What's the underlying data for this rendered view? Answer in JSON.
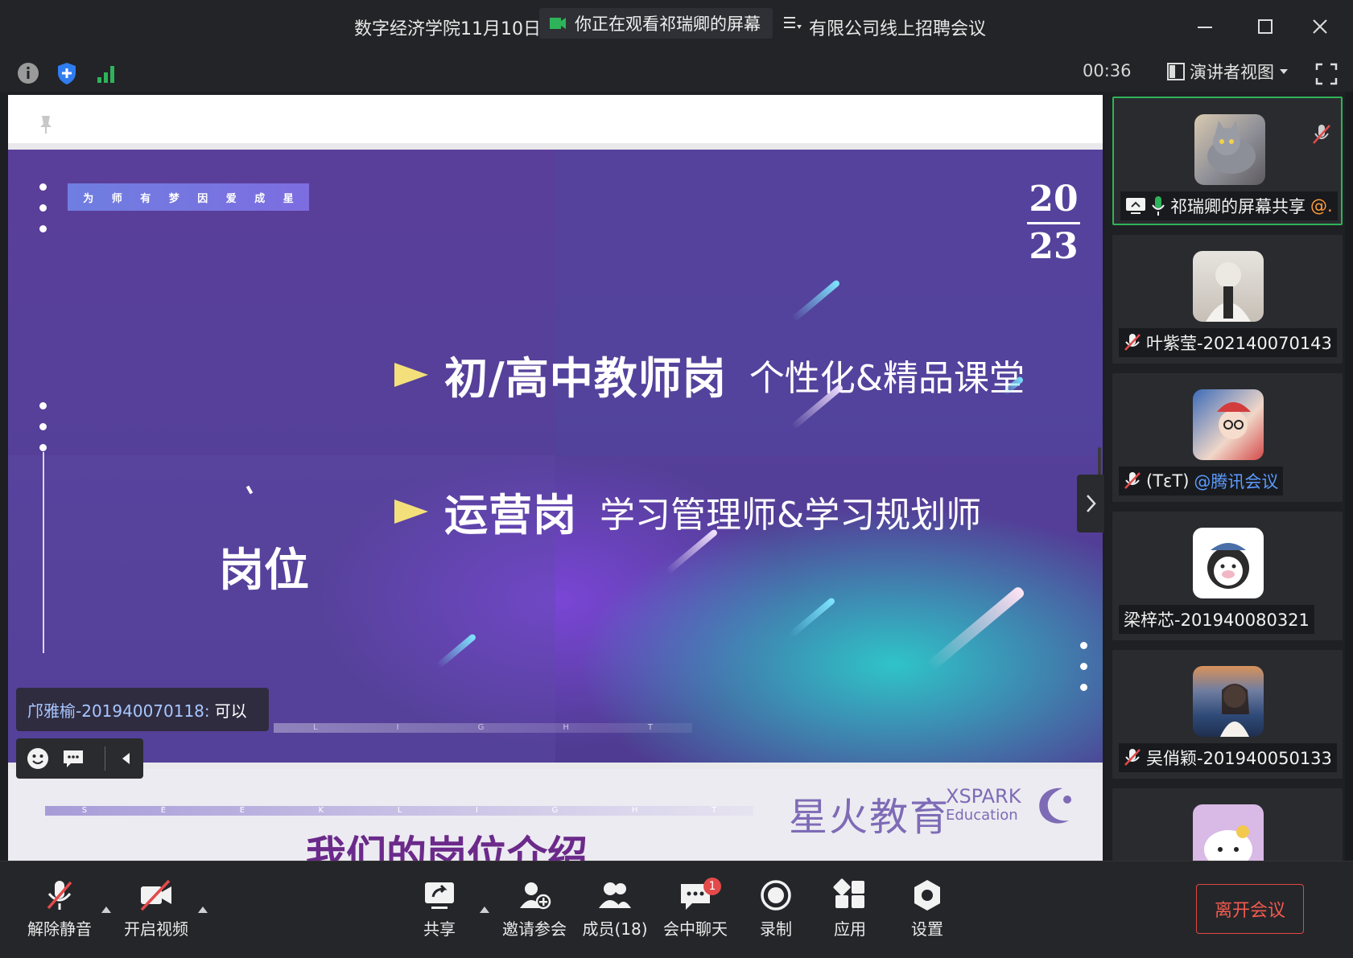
{
  "window": {
    "title_left": "数字经济学院11月10日",
    "title_right": "有限公司线上招聘会议",
    "viewing_banner": "你正在观看祁瑞卿的屏幕"
  },
  "status": {
    "timer": "00:36",
    "view_mode": "演讲者视图"
  },
  "slide": {
    "tagline": [
      "为",
      "师",
      "有",
      "梦",
      "因",
      "爱",
      "成",
      "星"
    ],
    "year_top": "20",
    "year_bottom": "23",
    "row1_main": "初/高中教师岗",
    "row1_sub": "个性化&精品课堂",
    "row2_main": "运营岗",
    "row2_sub": "学习管理师&学习规划师",
    "side_title": "岗位",
    "light_letters": [
      "L",
      "I",
      "G",
      "H",
      "T"
    ],
    "bottom_letters": [
      "S",
      "E",
      "E",
      "K",
      "L",
      "I",
      "G",
      "H",
      "T"
    ],
    "logo_cn": "星火教育",
    "logo_en_1": "XSPARK",
    "logo_en_2": "Education",
    "headline": "我们的岗位介绍"
  },
  "chat": {
    "sender": "邝雅榆-201940070118:",
    "message": "可以"
  },
  "participants": [
    {
      "name": "祁瑞卿的屏幕共享",
      "suffix": "@.",
      "active": true
    },
    {
      "name": "叶紫莹-202140070143",
      "suffix": "",
      "active": false
    },
    {
      "name": "(TεT)",
      "suffix": "@腾讯会议",
      "active": false
    },
    {
      "name": "梁梓芯-201940080321",
      "suffix": "",
      "active": false
    },
    {
      "name": "吴俏颖-201940050133",
      "suffix": "",
      "active": false
    }
  ],
  "toolbar": {
    "unmute": "解除静音",
    "start_video": "开启视频",
    "share": "共享",
    "invite": "邀请参会",
    "members": "成员(18)",
    "chat": "会中聊天",
    "chat_badge": "1",
    "record": "录制",
    "apps": "应用",
    "settings": "设置",
    "leave": "离开会议"
  },
  "colors": {
    "accent_green": "#2fb35a",
    "leave_red": "#e0483f",
    "link_blue": "#5b9bff"
  }
}
